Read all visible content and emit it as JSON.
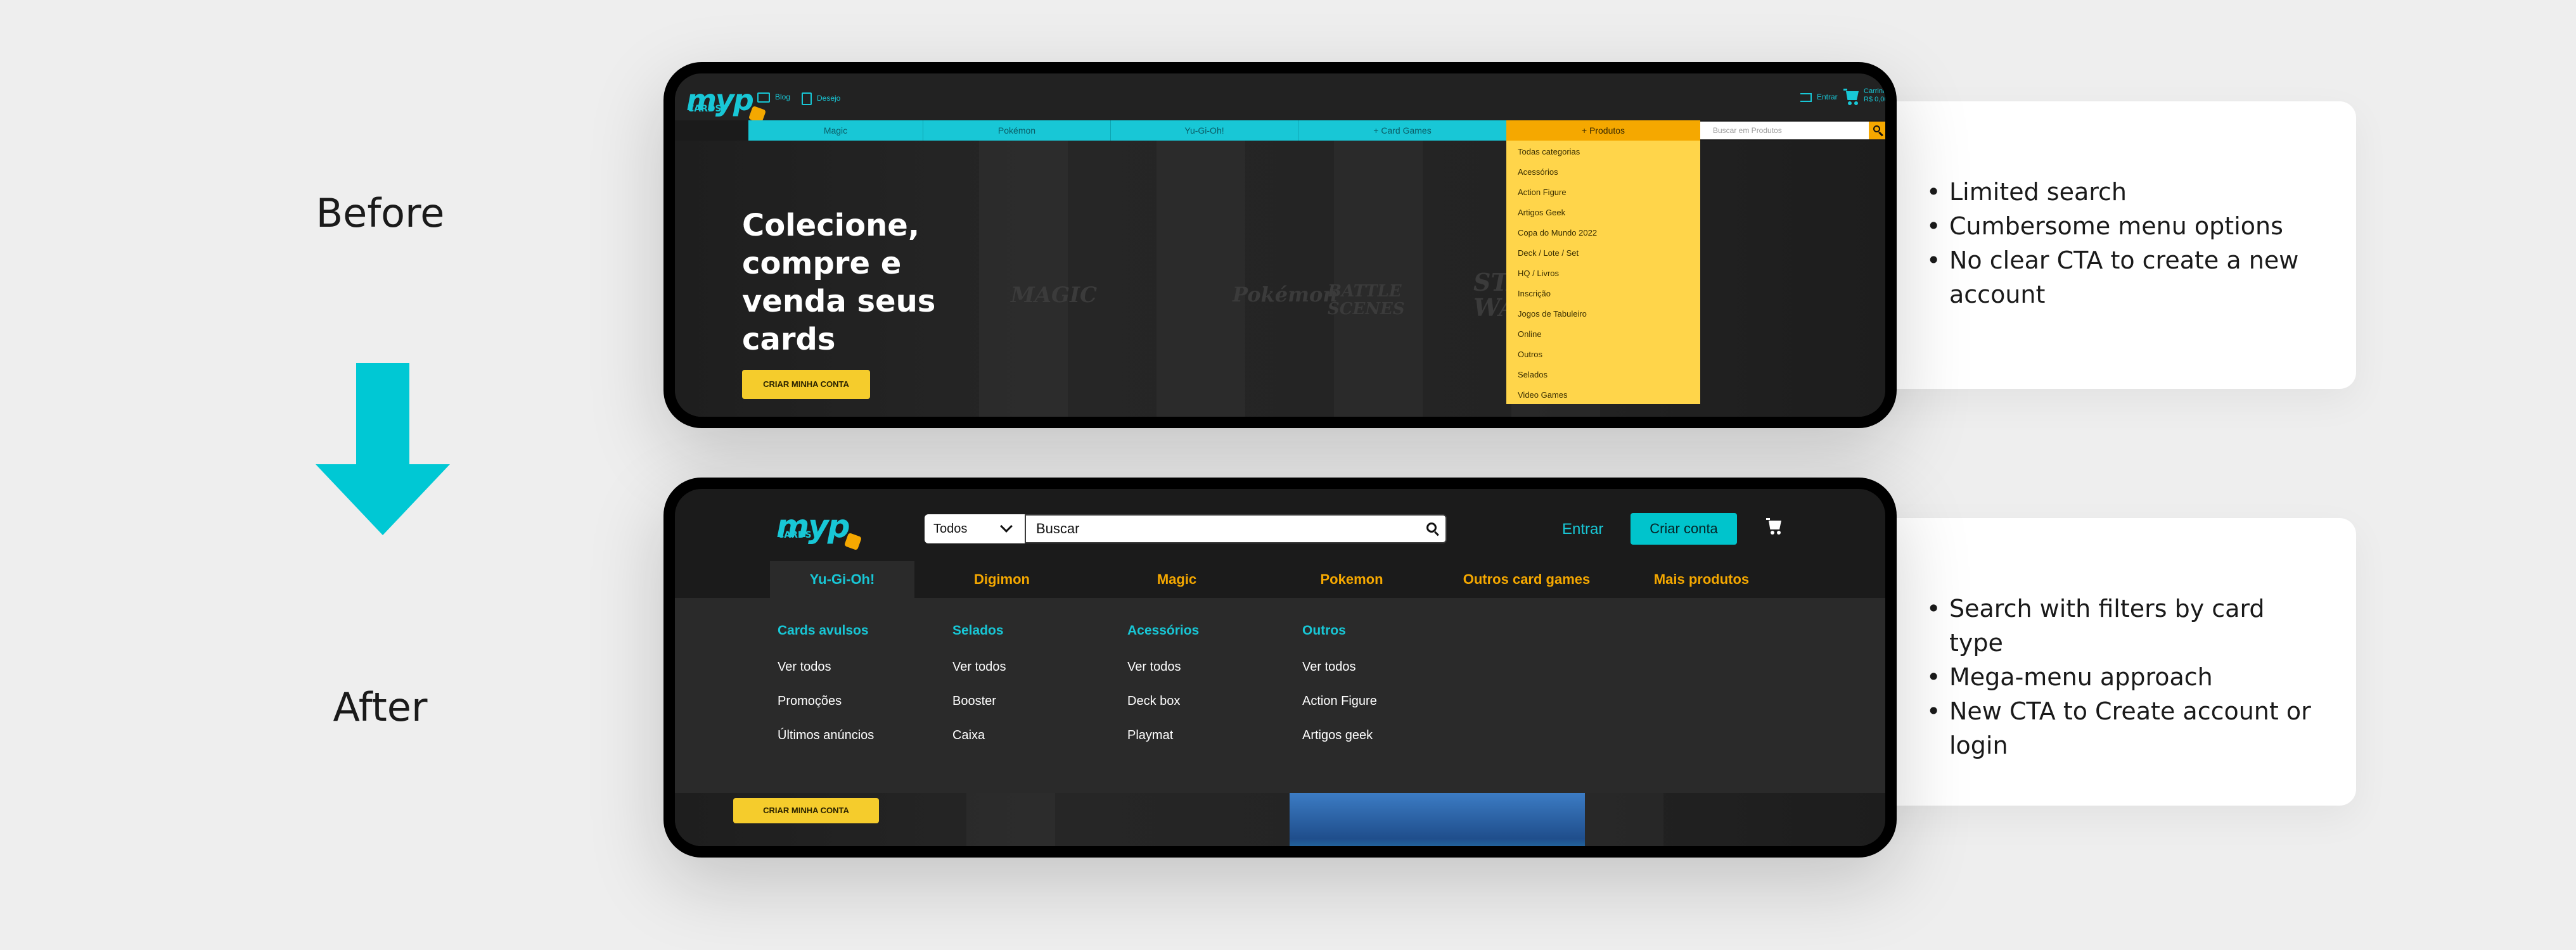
{
  "labels": {
    "before": "Before",
    "after": "After"
  },
  "colors": {
    "accent_cyan": "#00c8d4",
    "accent_yellow": "#f5cc2c",
    "accent_orange": "#f5a800",
    "dark_bg": "#1b1b1b"
  },
  "notes_before": [
    "Limited search",
    "Cumbersome menu options",
    "No clear CTA to create a new account"
  ],
  "notes_after": [
    "Search with filters by card type",
    "Mega-menu approach",
    "New CTA to Create account or login"
  ],
  "before": {
    "logo": "myp",
    "logo_sub": "CARDS",
    "links": {
      "blog": "Blog",
      "desejo": "Desejo"
    },
    "login": "Entrar",
    "cart_label": "Carrinho",
    "cart_total": "R$ 0,00",
    "nav": [
      "Magic",
      "Pokémon",
      "Yu-Gi-Oh!",
      "+ Card Games"
    ],
    "products": "+ Produtos",
    "search_placeholder": "Buscar em Produtos",
    "dropdown": [
      "Todas categorias",
      "Acessórios",
      "Action Figure",
      "Artigos Geek",
      "Copa do Mundo 2022",
      "Deck / Lote / Set",
      "HQ / Livros",
      "Inscrição",
      "Jogos de Tabuleiro",
      "Online",
      "Outros",
      "Selados",
      "Video Games"
    ],
    "hero_title": "Colecione, compre e venda seus cards",
    "cta": "CRIAR MINHA CONTA",
    "bg_logos": [
      "MAGIC",
      "Pokémon",
      "BATTLE SCENES",
      "STAR WARS"
    ]
  },
  "after": {
    "logo": "myp",
    "logo_sub": "CARDS",
    "filter_selected": "Todos",
    "search_value": "Buscar",
    "login": "Entrar",
    "create_account": "Criar conta",
    "tabs": [
      "Yu-Gi-Oh!",
      "Digimon",
      "Magic",
      "Pokemon",
      "Outros card games",
      "Mais produtos"
    ],
    "columns": [
      {
        "title": "Cards avulsos",
        "items": [
          "Ver todos",
          "Promoções",
          "Últimos anúncios"
        ]
      },
      {
        "title": "Selados",
        "items": [
          "Ver todos",
          "Booster",
          "Caixa"
        ]
      },
      {
        "title": "Acessórios",
        "items": [
          "Ver todos",
          "Deck box",
          "Playmat"
        ]
      },
      {
        "title": "Outros",
        "items": [
          "Ver todos",
          "Action Figure",
          "Artigos geek"
        ]
      }
    ],
    "cta": "CRIAR MINHA CONTA"
  }
}
